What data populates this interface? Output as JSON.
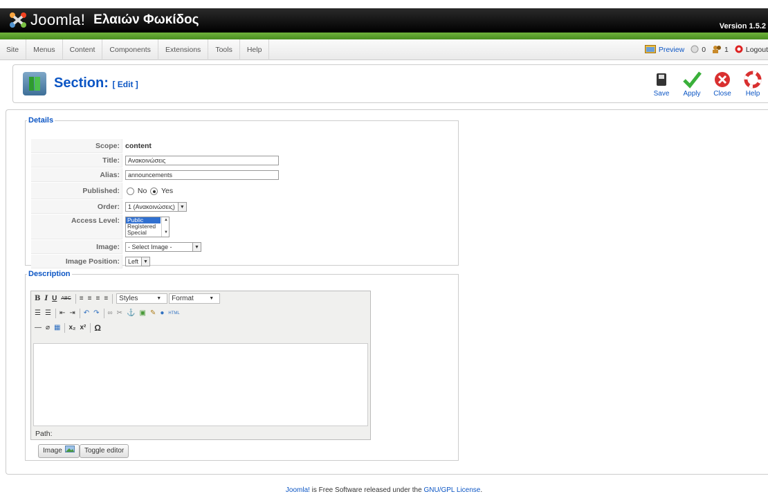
{
  "header": {
    "brand": "Joomla!",
    "site_name": "Ελαιών Φωκίδος",
    "version": "Version 1.5.2"
  },
  "menu": [
    "Site",
    "Menus",
    "Content",
    "Components",
    "Extensions",
    "Tools",
    "Help"
  ],
  "status": {
    "preview": "Preview",
    "messages": "0",
    "users": "1",
    "logout": "Logout"
  },
  "page": {
    "title": "Section:",
    "subtitle": "[ Edit ]"
  },
  "toolbar": {
    "save": "Save",
    "apply": "Apply",
    "close": "Close",
    "help": "Help"
  },
  "details": {
    "legend": "Details",
    "scope_label": "Scope:",
    "scope_value": "content",
    "title_label": "Title:",
    "title_value": "Ανακοινώσεις",
    "alias_label": "Alias:",
    "alias_value": "announcements",
    "published_label": "Published:",
    "published_no": "No",
    "published_yes": "Yes",
    "order_label": "Order:",
    "order_value": "1 (Ανακοινώσεις)",
    "access_label": "Access Level:",
    "access_options": [
      "Public",
      "Registered",
      "Special"
    ],
    "image_label": "Image:",
    "image_value": "- Select Image -",
    "image_pos_label": "Image Position:",
    "image_pos_value": "Left"
  },
  "description": {
    "legend": "Description",
    "styles": "Styles",
    "format": "Format",
    "path": "Path:",
    "image_btn": "Image",
    "toggle_btn": "Toggle editor"
  },
  "footer": {
    "link1": "Joomla!",
    "text": " is Free Software released under the ",
    "link2": "GNU/GPL License",
    "end": "."
  }
}
